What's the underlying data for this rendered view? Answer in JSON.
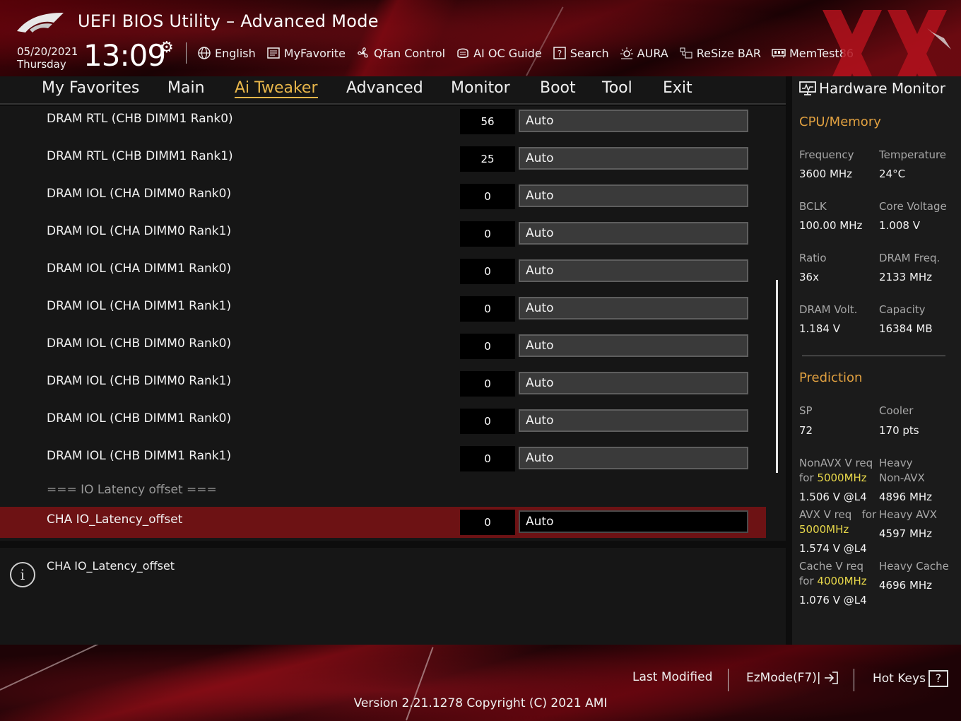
{
  "header": {
    "title": "UEFI BIOS Utility – Advanced Mode",
    "date": "05/20/2021",
    "day": "Thursday",
    "time": "13:09",
    "tools": [
      {
        "label": "English",
        "icon": "globe-icon"
      },
      {
        "label": "MyFavorite",
        "icon": "favorite-list-icon"
      },
      {
        "label": "Qfan Control",
        "icon": "fan-icon"
      },
      {
        "label": "AI OC Guide",
        "icon": "ai-oc-icon"
      },
      {
        "label": "Search",
        "icon": "question-box-icon"
      },
      {
        "label": "AURA",
        "icon": "aura-icon"
      },
      {
        "label": "ReSize BAR",
        "icon": "resize-bar-icon"
      },
      {
        "label": "MemTest86",
        "icon": "memtest-icon"
      }
    ]
  },
  "tabs": [
    {
      "label": "My Favorites",
      "active": false
    },
    {
      "label": "Main",
      "active": false
    },
    {
      "label": "Ai Tweaker",
      "active": true
    },
    {
      "label": "Advanced",
      "active": false
    },
    {
      "label": "Monitor",
      "active": false
    },
    {
      "label": "Boot",
      "active": false
    },
    {
      "label": "Tool",
      "active": false
    },
    {
      "label": "Exit",
      "active": false
    }
  ],
  "settings": [
    {
      "label": "DRAM RTL (CHB DIMM1 Rank0)",
      "current": "56",
      "value": "Auto"
    },
    {
      "label": "DRAM RTL (CHB DIMM1 Rank1)",
      "current": "25",
      "value": "Auto"
    },
    {
      "label": "DRAM IOL (CHA DIMM0 Rank0)",
      "current": "0",
      "value": "Auto"
    },
    {
      "label": "DRAM IOL (CHA DIMM0 Rank1)",
      "current": "0",
      "value": "Auto"
    },
    {
      "label": "DRAM IOL (CHA DIMM1 Rank0)",
      "current": "0",
      "value": "Auto"
    },
    {
      "label": "DRAM IOL (CHA DIMM1 Rank1)",
      "current": "0",
      "value": "Auto"
    },
    {
      "label": "DRAM IOL (CHB DIMM0 Rank0)",
      "current": "0",
      "value": "Auto"
    },
    {
      "label": "DRAM IOL (CHB DIMM0 Rank1)",
      "current": "0",
      "value": "Auto"
    },
    {
      "label": "DRAM IOL (CHB DIMM1 Rank0)",
      "current": "0",
      "value": "Auto"
    },
    {
      "label": "DRAM IOL (CHB DIMM1 Rank1)",
      "current": "0",
      "value": "Auto"
    }
  ],
  "section_title": "=== IO Latency offset ===",
  "selected_setting": {
    "label": "CHA IO_Latency_offset",
    "current": "0",
    "value": "Auto"
  },
  "help_text": "CHA IO_Latency_offset",
  "hw_monitor": {
    "title": "Hardware Monitor",
    "cpu_memory_title": "CPU/Memory",
    "frequency_label": "Frequency",
    "frequency": "3600 MHz",
    "temperature_label": "Temperature",
    "temperature": "24°C",
    "bclk_label": "BCLK",
    "bclk": "100.00 MHz",
    "core_voltage_label": "Core Voltage",
    "core_voltage": "1.008 V",
    "ratio_label": "Ratio",
    "ratio": "36x",
    "dram_freq_label": "DRAM Freq.",
    "dram_freq": "2133 MHz",
    "dram_volt_label": "DRAM Volt.",
    "dram_volt": "1.184 V",
    "capacity_label": "Capacity",
    "capacity": "16384 MB",
    "prediction_title": "Prediction",
    "sp_label": "SP",
    "sp": "72",
    "cooler_label": "Cooler",
    "cooler": "170 pts",
    "nonavx_label": "NonAVX V req",
    "for": "for",
    "nonavx_freq": "5000MHz",
    "nonavx_volt": "1.506 V @L4",
    "heavy_label": "Heavy",
    "heavy_nonavx_label": "Non-AVX",
    "heavy_nonavx": "4896 MHz",
    "avx_label": "AVX V req",
    "for_inline": "for",
    "avx_freq": "5000MHz",
    "avx_volt": "1.574 V @L4",
    "heavy_avx_label": "Heavy AVX",
    "heavy_avx": "4597 MHz",
    "cache_label": "Cache V req",
    "cache_freq": "4000MHz",
    "cache_volt": "1.076 V @L4",
    "heavy_cache_label": "Heavy Cache",
    "heavy_cache": "4696 MHz"
  },
  "footer": {
    "last_modified": "Last Modified",
    "ezmode": "EzMode(F7)|",
    "hotkeys": "Hot Keys",
    "hotkeys_box": "?",
    "version": "Version 2.21.1278 Copyright (C) 2021 AMI"
  },
  "colors": {
    "accent": "#e8b64a",
    "selected_row": "#6d1214",
    "brand_red": "#b0101c",
    "highlight": "#e8d84a"
  }
}
